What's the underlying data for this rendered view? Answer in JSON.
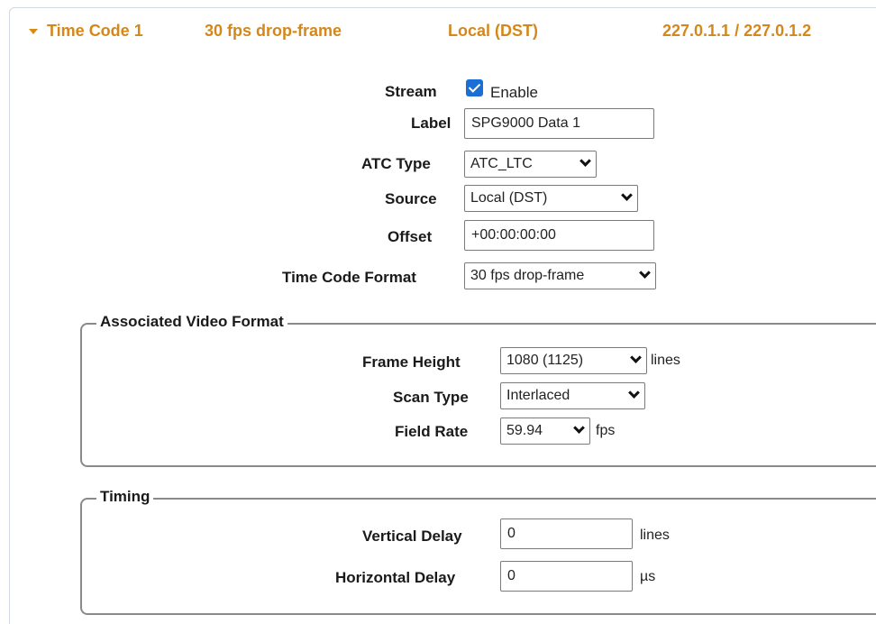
{
  "header": {
    "title": "Time Code 1",
    "format": "30 fps drop-frame",
    "source": "Local (DST)",
    "addresses": "227.0.1.1 / 227.0.1.2"
  },
  "stream": {
    "label": "Stream",
    "enable_label": "Enable",
    "enabled": true
  },
  "label_field": {
    "label": "Label",
    "value": "SPG9000 Data 1"
  },
  "atc_type": {
    "label": "ATC Type",
    "value": "ATC_LTC"
  },
  "source": {
    "label": "Source",
    "value": "Local (DST)"
  },
  "offset": {
    "label": "Offset",
    "value": "+00:00:00:00"
  },
  "time_code_format": {
    "label": "Time Code Format",
    "value": "30 fps drop-frame"
  },
  "associated_video": {
    "legend": "Associated Video Format",
    "frame_height": {
      "label": "Frame Height",
      "value": "1080 (1125)",
      "unit": "lines"
    },
    "scan_type": {
      "label": "Scan Type",
      "value": "Interlaced"
    },
    "field_rate": {
      "label": "Field Rate",
      "value": "59.94",
      "unit": "fps"
    }
  },
  "timing": {
    "legend": "Timing",
    "vertical_delay": {
      "label": "Vertical Delay",
      "value": "0",
      "unit": "lines"
    },
    "horizontal_delay": {
      "label": "Horizontal Delay",
      "value": "0",
      "unit": "µs"
    }
  },
  "colors": {
    "accent": "#d4871b",
    "checkbox": "#1a6fd6"
  },
  "icons": {
    "expand": "caret-down-icon",
    "dropdown": "chevron-down-icon",
    "check": "checkmark-icon"
  }
}
